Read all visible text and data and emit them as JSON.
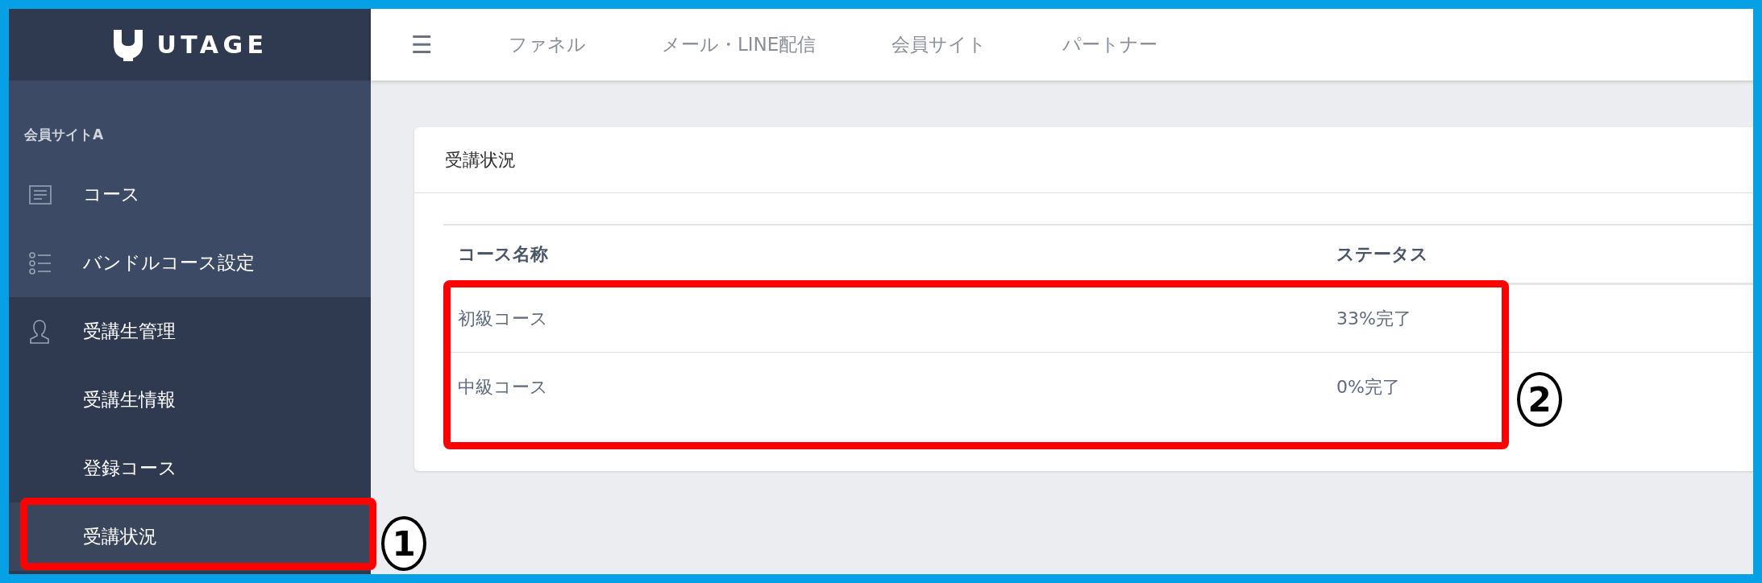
{
  "logo": {
    "text": "UTAGE"
  },
  "header": {
    "menu_icon": "☰",
    "nav": [
      {
        "label": "ファネル",
        "selected": false
      },
      {
        "label": "メール・LINE配信",
        "selected": false
      },
      {
        "label": "会員サイト",
        "selected": false
      },
      {
        "label": "パートナー",
        "selected": false
      }
    ]
  },
  "sidebar": {
    "site": {
      "label": "会員サイトA",
      "items": [
        {
          "label": "コース",
          "selected": false
        },
        {
          "label": "バンドルコース設定",
          "selected": false
        }
      ]
    },
    "items": [
      {
        "label": "受講生管理",
        "selected": false,
        "children": [
          {
            "label": "受講生情報",
            "selected": false
          },
          {
            "label": "登録コース",
            "selected": false
          },
          {
            "label": "受講状況",
            "selected": true
          }
        ]
      }
    ]
  },
  "card": {
    "title": "受講状況",
    "table": {
      "columns": [
        "コース名称",
        "ステータス"
      ],
      "rows": [
        [
          "初級コース",
          "33%完了"
        ],
        [
          "中級コース",
          "0%完了"
        ]
      ]
    }
  },
  "annotations": [
    {
      "number": "1"
    },
    {
      "number": "2"
    }
  ]
}
